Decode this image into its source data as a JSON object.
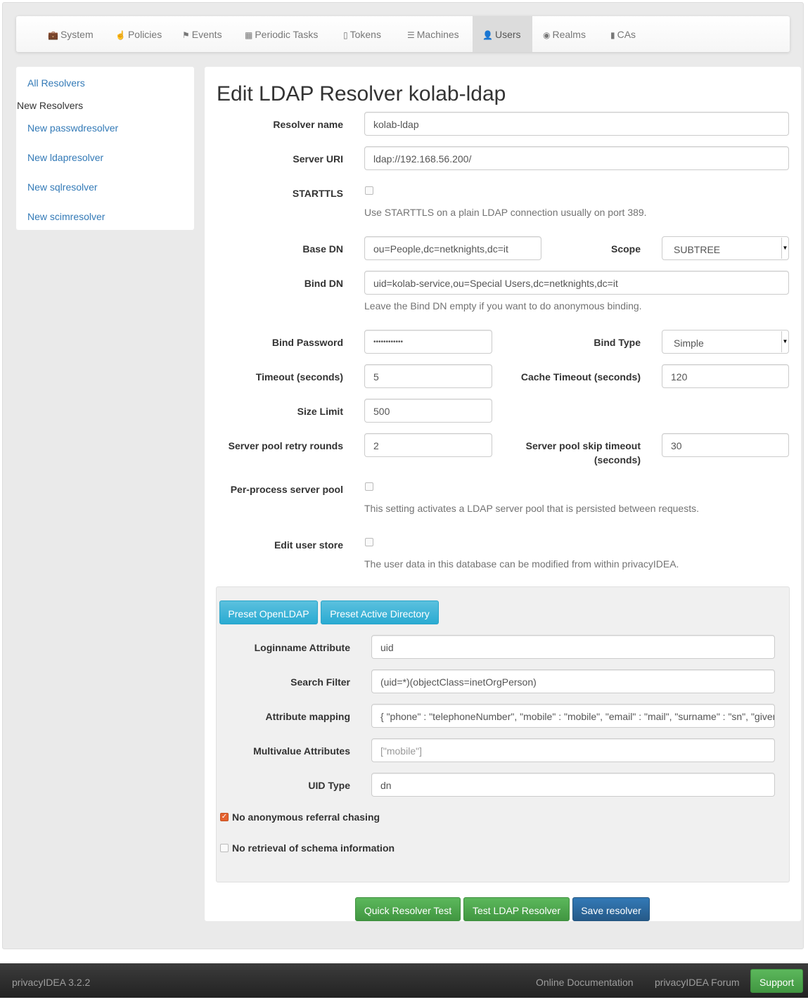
{
  "nav": {
    "items": [
      {
        "label": "System",
        "icon": "briefcase-icon"
      },
      {
        "label": "Policies",
        "icon": "hand-pointer-icon"
      },
      {
        "label": "Events",
        "icon": "flag-icon"
      },
      {
        "label": "Periodic Tasks",
        "icon": "calendar-icon"
      },
      {
        "label": "Tokens",
        "icon": "phone-icon"
      },
      {
        "label": "Machines",
        "icon": "server-icon"
      },
      {
        "label": "Users",
        "icon": "user-icon",
        "active": true
      },
      {
        "label": "Realms",
        "icon": "globe-icon"
      },
      {
        "label": "CAs",
        "icon": "bookmark-icon"
      }
    ]
  },
  "sidebar": {
    "all": "All Resolvers",
    "header": "New Resolvers",
    "items": [
      "New passwdresolver",
      "New ldapresolver",
      "New sqlresolver",
      "New scimresolver"
    ]
  },
  "main": {
    "title": "Edit LDAP Resolver kolab-ldap",
    "resolver_name": {
      "label": "Resolver name",
      "value": "kolab-ldap"
    },
    "server_uri": {
      "label": "Server URI",
      "value": "ldap://192.168.56.200/"
    },
    "starttls": {
      "label": "STARTTLS",
      "checked": false,
      "help": "Use STARTTLS on a plain LDAP connection usually on port 389."
    },
    "base_dn": {
      "label": "Base DN",
      "value": "ou=People,dc=netknights,dc=it"
    },
    "scope": {
      "label": "Scope",
      "value": "SUBTREE"
    },
    "bind_dn": {
      "label": "Bind DN",
      "value": "uid=kolab-service,ou=Special Users,dc=netknights,dc=it",
      "help": "Leave the Bind DN empty if you want to do anonymous binding."
    },
    "bind_password": {
      "label": "Bind Password",
      "value": "••••••••••••"
    },
    "bind_type": {
      "label": "Bind Type",
      "value": "Simple"
    },
    "timeout": {
      "label": "Timeout (seconds)",
      "value": "5"
    },
    "cache_timeout": {
      "label": "Cache Timeout (seconds)",
      "value": "120"
    },
    "size_limit": {
      "label": "Size Limit",
      "value": "500"
    },
    "retry_rounds": {
      "label": "Server pool retry rounds",
      "value": "2"
    },
    "skip_timeout": {
      "label1": "Server pool skip timeout",
      "label2": "(seconds)",
      "value": "30"
    },
    "per_process": {
      "label": "Per-process server pool",
      "checked": false,
      "help": "This setting activates a LDAP server pool that is persisted between requests."
    },
    "edit_user_store": {
      "label": "Edit user store",
      "checked": false,
      "help": "The user data in this database can be modified from within privacyIDEA."
    },
    "preset_openldap": "Preset OpenLDAP",
    "preset_ad": "Preset Active Directory",
    "loginname": {
      "label": "Loginname Attribute",
      "value": "uid"
    },
    "search_filter": {
      "label": "Search Filter",
      "value": "(uid=*)(objectClass=inetOrgPerson)"
    },
    "attr_mapping": {
      "label": "Attribute mapping",
      "value": "{ \"phone\" : \"telephoneNumber\", \"mobile\" : \"mobile\", \"email\" : \"mail\", \"surname\" : \"sn\", \"givenname\" : \"givenName\" }"
    },
    "multivalue": {
      "label": "Multivalue Attributes",
      "placeholder": "[\"mobile\"]"
    },
    "uid_type": {
      "label": "UID Type",
      "value": "dn"
    },
    "no_referral": {
      "label": "No anonymous referral chasing",
      "checked": true
    },
    "no_schema": {
      "label": "No retrieval of schema information",
      "checked": false
    },
    "quick_test": "Quick Resolver Test",
    "test_ldap": "Test LDAP Resolver",
    "save": "Save resolver"
  },
  "footer": {
    "version": "privacyIDEA 3.2.2",
    "docs": "Online Documentation",
    "forum": "privacyIDEA Forum",
    "support": "Support"
  },
  "colors": {
    "info": "#5bc0de",
    "success": "#5cb85c",
    "primary": "#337ab7",
    "checkbox": "#e5622f"
  }
}
